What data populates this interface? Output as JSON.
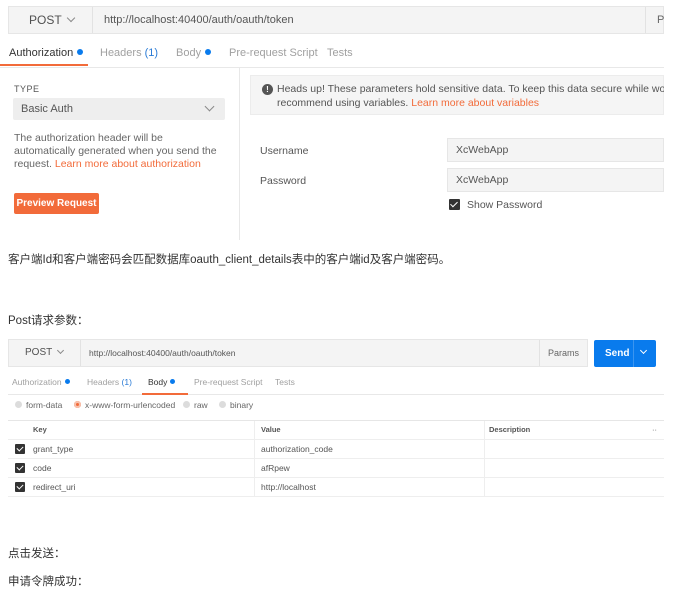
{
  "auth_panel": {
    "method": "POST",
    "url": "http://localhost:40400/auth/oauth/token",
    "params_label": "P",
    "tabs": [
      {
        "label": "Authorization",
        "count": "",
        "dot": true
      },
      {
        "label": "Headers",
        "count": "(1)",
        "dot": false
      },
      {
        "label": "Body",
        "count": "",
        "dot": true
      },
      {
        "label": "Pre-request Script",
        "count": "",
        "dot": false
      },
      {
        "label": "Tests",
        "count": "",
        "dot": false
      }
    ],
    "type_label": "TYPE",
    "type_value": "Basic Auth",
    "help_text": "The authorization header will be automatically generated when you send the request.",
    "help_link": "Learn more about authorization",
    "preview_button": "Preview Request",
    "notice_text_1": "Heads up! These parameters hold sensitive data. To keep this data secure while working in a",
    "notice_text_2": "recommend using variables.",
    "notice_link": "Learn more about variables",
    "username_label": "Username",
    "username_value": "XcWebApp",
    "password_label": "Password",
    "password_value": "XcWebApp",
    "show_password_label": "Show Password",
    "show_password_checked": true
  },
  "text": {
    "para1": "客户端Id和客户端密码会匹配数据库oauth_client_details表中的客户端id及客户端密码。",
    "para2": "Post请求参数：",
    "para3": "点击发送：",
    "para4": "申请令牌成功："
  },
  "body_panel": {
    "method": "POST",
    "url": "http://localhost:40400/auth/oauth/token",
    "params_button": "Params",
    "send_button": "Send",
    "tabs": [
      {
        "label": "Authorization",
        "count": "",
        "dot": true
      },
      {
        "label": "Headers",
        "count": "(1)",
        "dot": false
      },
      {
        "label": "Body",
        "count": "",
        "dot": true
      },
      {
        "label": "Pre-request Script",
        "count": "",
        "dot": false
      },
      {
        "label": "Tests",
        "count": "",
        "dot": false
      }
    ],
    "body_modes": [
      {
        "label": "form-data",
        "selected": false
      },
      {
        "label": "x-www-form-urlencoded",
        "selected": true
      },
      {
        "label": "raw",
        "selected": false
      },
      {
        "label": "binary",
        "selected": false
      }
    ],
    "columns": {
      "key": "Key",
      "value": "Value",
      "description": "Description",
      "more": "··"
    },
    "rows": [
      {
        "checked": true,
        "key": "grant_type",
        "value": "authorization_code",
        "description": ""
      },
      {
        "checked": true,
        "key": "code",
        "value": "afRpew",
        "description": ""
      },
      {
        "checked": true,
        "key": "redirect_uri",
        "value": "http://localhost",
        "description": ""
      }
    ]
  },
  "colors": {
    "accent_orange": "#f26b3a",
    "accent_blue": "#097bed"
  }
}
